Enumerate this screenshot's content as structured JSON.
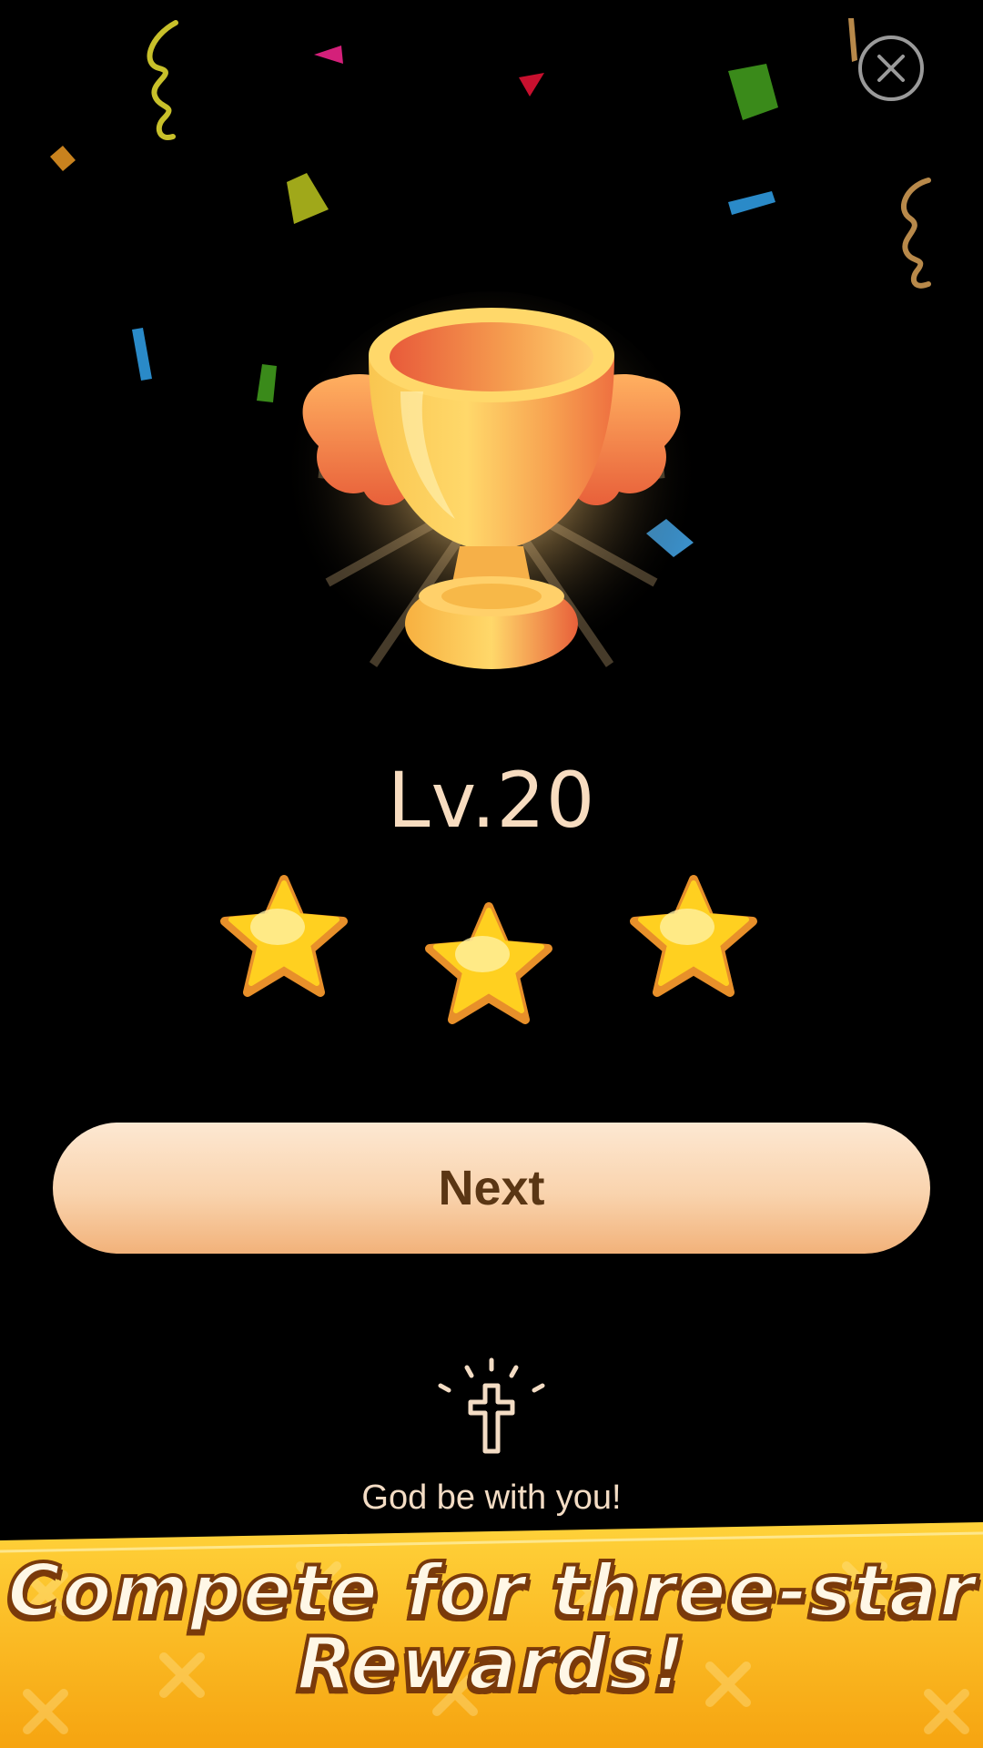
{
  "close": {
    "icon": "close-icon"
  },
  "trophy": {
    "icon": "winged-trophy-icon"
  },
  "level": {
    "label": "Lv.20"
  },
  "rating": {
    "stars_earned": 3,
    "stars_total": 3,
    "icon": "star-icon"
  },
  "actions": {
    "next_label": "Next"
  },
  "blessing": {
    "icon": "cross-icon",
    "text": "God be with you!"
  },
  "promo": {
    "line1": "Compete for three-star",
    "line2": "Rewards!"
  },
  "colors": {
    "background": "#000000",
    "accent_gold": "#f7b318",
    "button": "#f9d3ad",
    "text_light": "#f7dcc0"
  }
}
